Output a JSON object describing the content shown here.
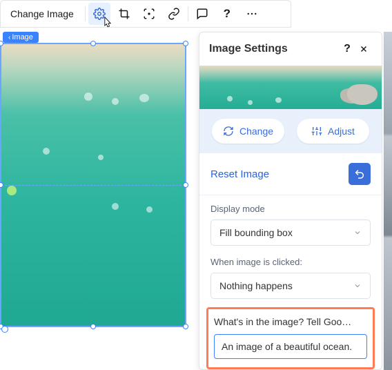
{
  "toolbar": {
    "change_image_label": "Change Image",
    "icons": {
      "settings": "gear-icon",
      "crop": "crop-icon",
      "focal": "focal-point-icon",
      "link": "link-icon",
      "comment": "comment-icon",
      "help": "help-icon",
      "more": "more-icon"
    }
  },
  "badge": {
    "label": "Image"
  },
  "panel": {
    "title": "Image Settings",
    "actions": {
      "change_label": "Change",
      "adjust_label": "Adjust"
    },
    "reset_label": "Reset Image",
    "display_mode": {
      "label": "Display mode",
      "value": "Fill bounding box"
    },
    "click_action": {
      "label": "When image is clicked:",
      "value": "Nothing happens"
    },
    "alt_text": {
      "label": "What's in the image? Tell Goo…",
      "value": "An image of a beautiful ocean."
    }
  }
}
